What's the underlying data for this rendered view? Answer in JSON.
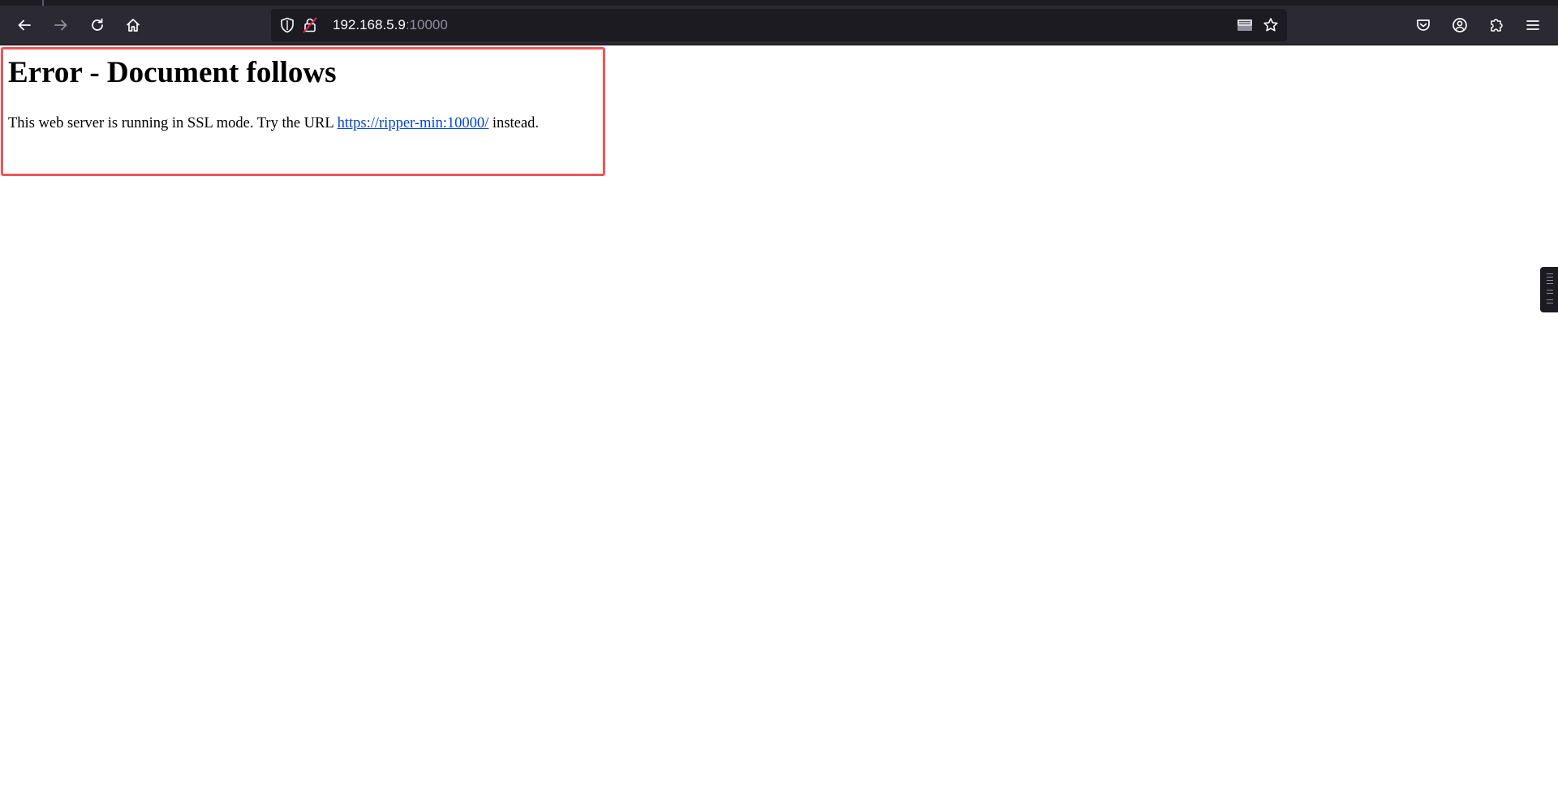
{
  "browser": {
    "url_host": "192.168.5.9",
    "url_port": ":10000",
    "toolbar_icons": {
      "back": "back-arrow-icon",
      "forward": "forward-arrow-icon",
      "reload": "reload-icon",
      "home": "home-icon",
      "tracking_protection": "shield-icon",
      "insecure_connection": "insecure-lock-icon",
      "reader_view": "reader-view-icon",
      "bookmark": "bookmark-star-icon",
      "pocket": "pocket-icon",
      "account": "account-icon",
      "extensions": "extensions-puzzle-icon",
      "menu": "hamburger-menu-icon"
    },
    "colors": {
      "chrome_bg": "#2b2a33",
      "urlbar_bg": "#1c1b22",
      "icon": "#fbfbfe",
      "insecure_accent": "#e22850"
    }
  },
  "page": {
    "heading": "Error - Document follows",
    "message_before": "This web server is running in SSL mode. Try the URL ",
    "link_text": "https://ripper-min:10000/",
    "message_after": " instead.",
    "colors": {
      "highlight_border": "#f0555b",
      "link": "#0645c8"
    }
  }
}
